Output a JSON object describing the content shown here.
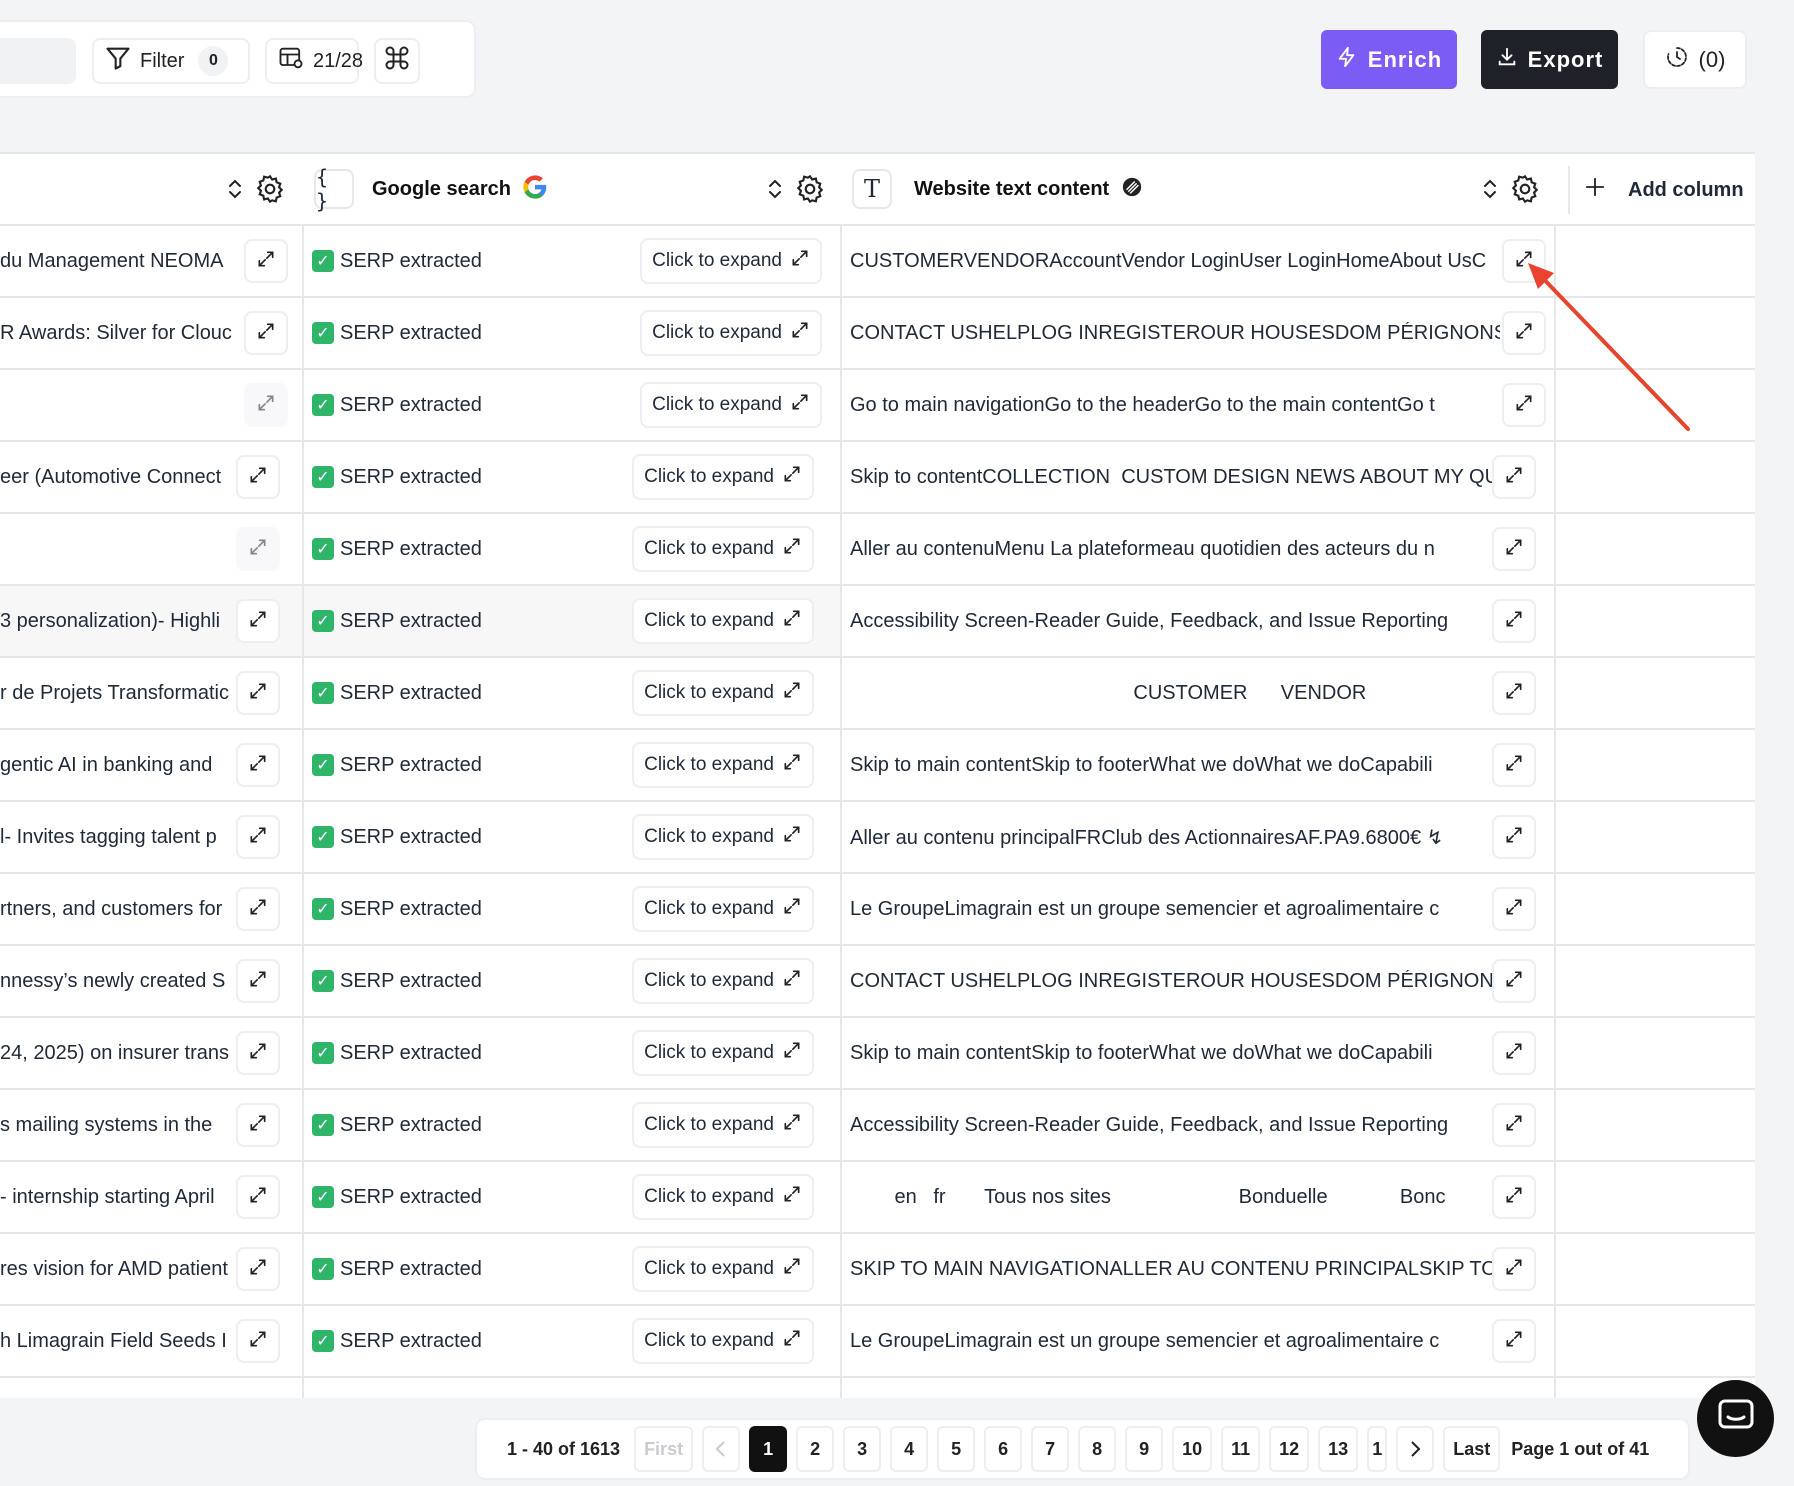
{
  "toolbar": {
    "filter_label": "Filter",
    "filter_count": "0",
    "columns_label": "21/28",
    "enrich_label": "Enrich",
    "export_label": "Export",
    "history_label": "(0)"
  },
  "columns": {
    "google": "Google search",
    "website": "Website text content",
    "add": "Add column"
  },
  "colors": {
    "enrich": "#7b5cf5",
    "export": "#1f2128",
    "active_page": "#111111"
  },
  "rows": [
    {
      "c1": "du Management NEOMA",
      "status": "SERP extracted",
      "expand": "Click to expand",
      "web": "CUSTOMERVENDORAccountVendor LoginUser LoginHomeAbout UsC"
    },
    {
      "c1": "R Awards: Silver for Clouc",
      "status": "SERP extracted",
      "expand": "Click to expand",
      "web": "CONTACT USHELPLOG INREGISTEROUR HOUSESDOM PÉRIGNONSince"
    },
    {
      "c1": "",
      "status": "SERP extracted",
      "expand": "Click to expand",
      "web": "Go to main navigationGo to the headerGo to the main contentGo t"
    },
    {
      "c1": "eer (Automotive Connect",
      "status": "SERP extracted",
      "expand": "Click to expand",
      "web": "Skip to contentCOLLECTION  CUSTOM DESIGN NEWS ABOUT MY QUEU"
    },
    {
      "c1": "",
      "status": "SERP extracted",
      "expand": "Click to expand",
      "web": "Aller au contenuMenu La plateformeau quotidien des acteurs du n"
    },
    {
      "c1": "3 personalization)- Highli",
      "status": "SERP extracted",
      "expand": "Click to expand",
      "web": "Accessibility Screen-Reader Guide, Feedback, and Issue Reporting"
    },
    {
      "c1": "r de Projets Transformatic",
      "status": "SERP extracted",
      "expand": "Click to expand",
      "web": "                                                   CUSTOMER      VENDOR"
    },
    {
      "c1": "gentic AI in banking and",
      "status": "SERP extracted",
      "expand": "Click to expand",
      "web": "Skip to main contentSkip to footerWhat we doWhat we doCapabili"
    },
    {
      "c1": "l- Invites tagging talent p",
      "status": "SERP extracted",
      "expand": "Click to expand",
      "web": "Aller au contenu principalFRClub des ActionnairesAF.PA9.6800€ ↯"
    },
    {
      "c1": "rtners, and customers for",
      "status": "SERP extracted",
      "expand": "Click to expand",
      "web": "Le GroupeLimagrain est un groupe semencier et agroalimentaire c"
    },
    {
      "c1": "nnessy’s newly created S",
      "status": "SERP extracted",
      "expand": "Click to expand",
      "web": "CONTACT USHELPLOG INREGISTEROUR HOUSESDOM PÉRIGNONSince"
    },
    {
      "c1": "24, 2025) on insurer trans",
      "status": "SERP extracted",
      "expand": "Click to expand",
      "web": "Skip to main contentSkip to footerWhat we doWhat we doCapabili"
    },
    {
      "c1": "s mailing systems in the",
      "status": "SERP extracted",
      "expand": "Click to expand",
      "web": "Accessibility Screen-Reader Guide, Feedback, and Issue Reporting"
    },
    {
      "c1": "- internship starting April",
      "status": "SERP extracted",
      "expand": "Click to expand",
      "web": "        en   fr       Tous nos sites                       Bonduelle             Bonc"
    },
    {
      "c1": "res vision for AMD patient",
      "status": "SERP extracted",
      "expand": "Click to expand",
      "web": "SKIP TO MAIN NAVIGATIONALLER AU CONTENU PRINCIPALSKIP TO SEA"
    },
    {
      "c1": "h Limagrain Field Seeds I",
      "status": "SERP extracted",
      "expand": "Click to expand",
      "web": "Le GroupeLimagrain est un groupe semencier et agroalimentaire c"
    }
  ],
  "pagination": {
    "range": "1 - 40 of 1613",
    "first": "First",
    "pages": [
      "1",
      "2",
      "3",
      "4",
      "5",
      "6",
      "7",
      "8",
      "9",
      "10",
      "11",
      "12",
      "13",
      "1"
    ],
    "last": "Last",
    "info": "Page 1 out of 41"
  }
}
